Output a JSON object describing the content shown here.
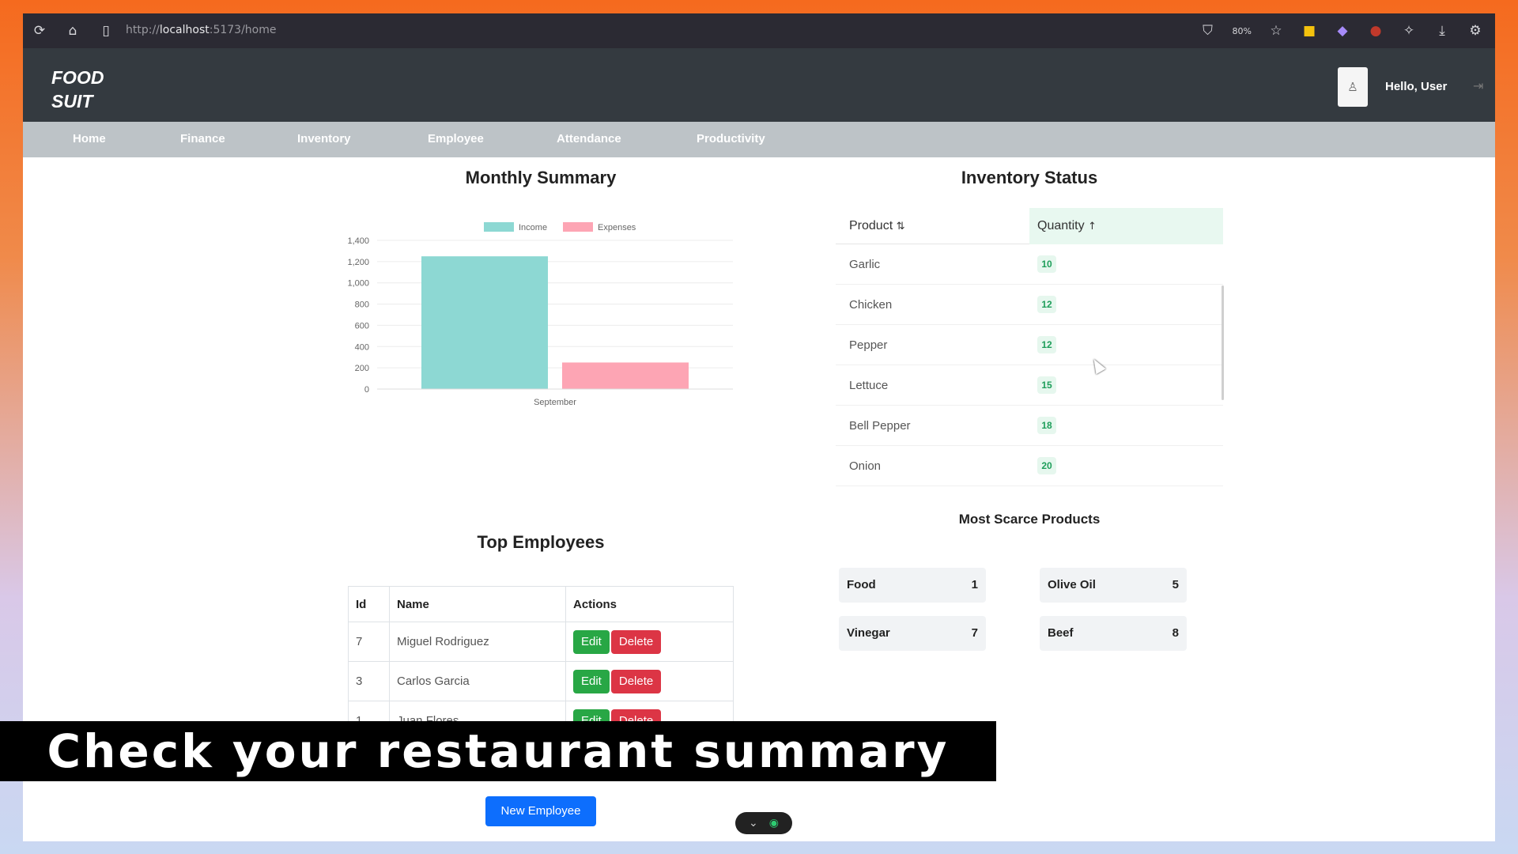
{
  "browser": {
    "url_prefix": "http://",
    "url_host": "localhost",
    "url_rest": ":5173/home",
    "zoom": "80%"
  },
  "app": {
    "logo_line1": "FOOD",
    "logo_line2": "SUIT",
    "greeting": "Hello, User"
  },
  "nav": [
    "Home",
    "Finance",
    "Inventory",
    "Employee",
    "Attendance",
    "Productivity"
  ],
  "monthly": {
    "title": "Monthly Summary"
  },
  "chart_data": {
    "type": "bar",
    "categories": [
      "September"
    ],
    "series": [
      {
        "name": "Income",
        "values": [
          1250
        ],
        "color": "#8dd8d3"
      },
      {
        "name": "Expenses",
        "values": [
          250
        ],
        "color": "#fda5b4"
      }
    ],
    "yticks": [
      "0",
      "200",
      "400",
      "600",
      "800",
      "1,000",
      "1,200",
      "1,400"
    ],
    "ylim": [
      0,
      1400
    ],
    "legend": "top",
    "grid": true
  },
  "inventory": {
    "title": "Inventory Status",
    "col_product": "Product",
    "col_quantity": "Quantity",
    "rows": [
      {
        "product": "Garlic",
        "qty": "10"
      },
      {
        "product": "Chicken",
        "qty": "12"
      },
      {
        "product": "Pepper",
        "qty": "12"
      },
      {
        "product": "Lettuce",
        "qty": "15"
      },
      {
        "product": "Bell Pepper",
        "qty": "18"
      },
      {
        "product": "Onion",
        "qty": "20"
      }
    ]
  },
  "scarce": {
    "title": "Most Scarce Products",
    "items": [
      {
        "name": "Food",
        "count": "1"
      },
      {
        "name": "Olive Oil",
        "count": "5"
      },
      {
        "name": "Vinegar",
        "count": "7"
      },
      {
        "name": "Beef",
        "count": "8"
      }
    ]
  },
  "employees": {
    "title": "Top Employees",
    "col_id": "Id",
    "col_name": "Name",
    "col_actions": "Actions",
    "edit_label": "Edit",
    "delete_label": "Delete",
    "rows": [
      {
        "id": "7",
        "name": "Miguel Rodriguez"
      },
      {
        "id": "3",
        "name": "Carlos Garcia"
      },
      {
        "id": "1",
        "name": "Juan Flores"
      }
    ],
    "new_button": "New Employee"
  },
  "caption": "Check your restaurant summary"
}
